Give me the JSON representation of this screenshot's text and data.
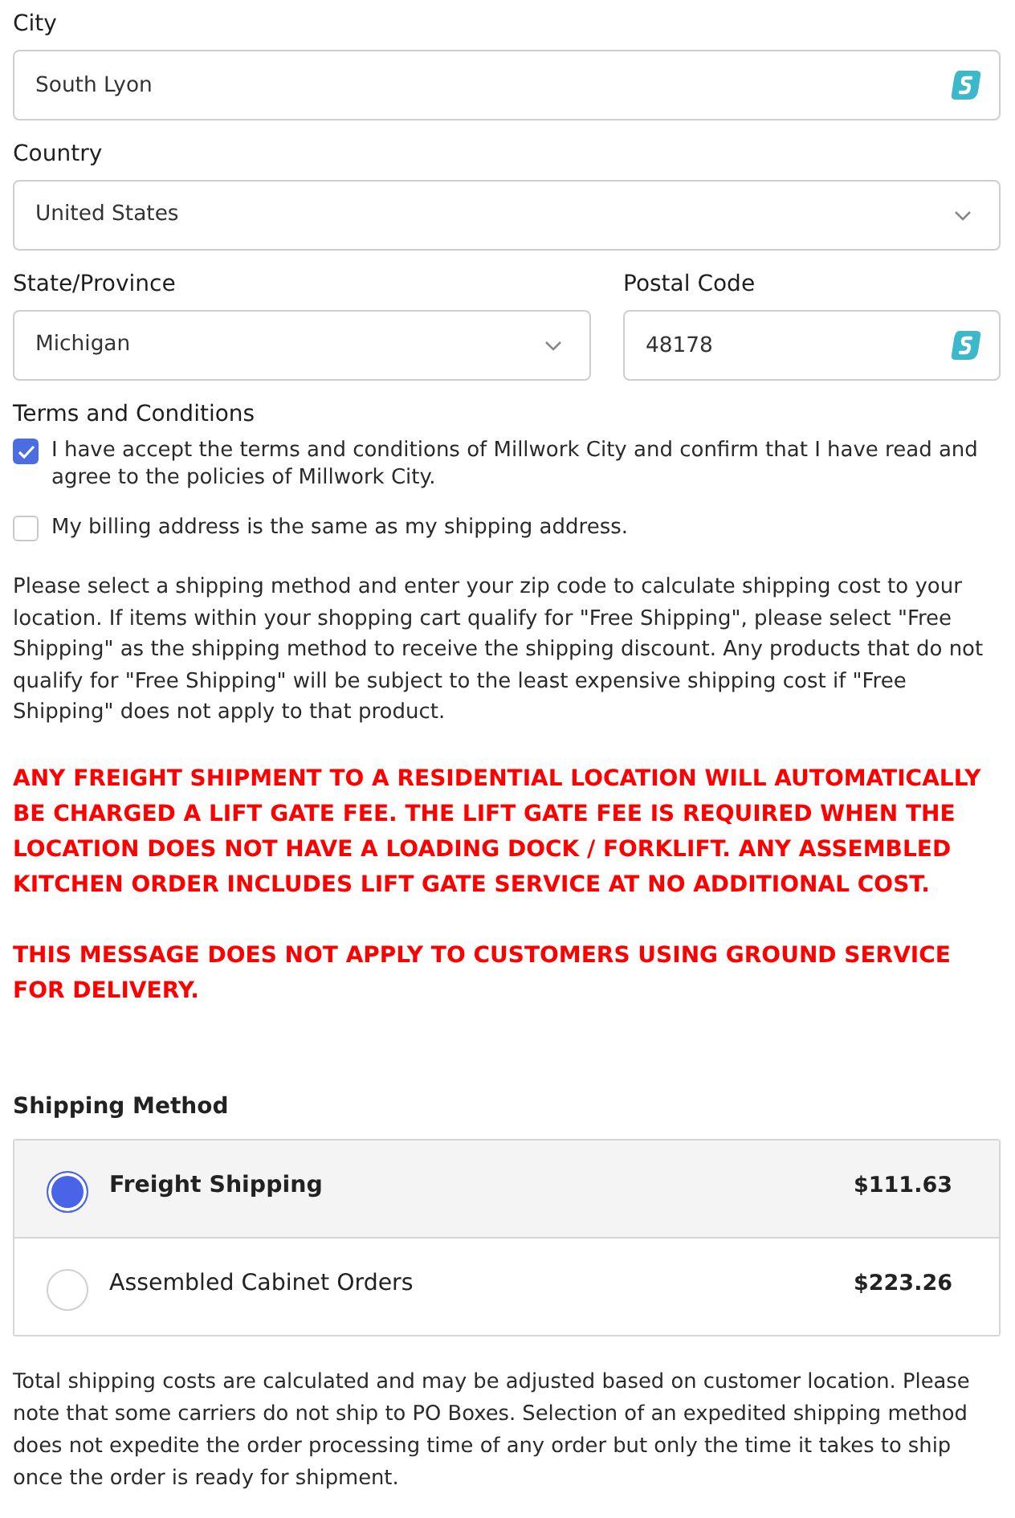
{
  "address_rows": [
    {
      "fields": [
        {
          "kind": "text",
          "label": "City",
          "value": "South Lyon"
        }
      ]
    },
    {
      "fields": [
        {
          "kind": "select",
          "label": "Country",
          "value": "United States"
        }
      ]
    },
    {
      "fields": [
        {
          "kind": "select",
          "label": "State/Province",
          "value": "Michigan"
        },
        {
          "kind": "text",
          "label": "Postal Code",
          "value": "48178"
        }
      ]
    }
  ],
  "terms": {
    "heading": "Terms and Conditions",
    "checkboxes": [
      {
        "label": "I have accept the terms and conditions of Millwork City and confirm that I have read and agree to the policies of Millwork City.",
        "checked": true
      },
      {
        "label": "My billing address is the same as my shipping address.",
        "checked": false
      }
    ]
  },
  "shipping_note": "Please select a shipping method and enter your zip code to calculate shipping cost to your location. If items within your shopping cart qualify for \"Free Shipping\", please select \"Free Shipping\" as the shipping method to receive the shipping discount. Any products that do not qualify for \"Free Shipping\" will be subject to the least expensive shipping cost if \"Free Shipping\" does not apply to that product.",
  "warnings": [
    "ANY FREIGHT SHIPMENT TO A RESIDENTIAL LOCATION WILL AUTOMATICALLY BE CHARGED A LIFT GATE FEE. THE LIFT GATE FEE IS REQUIRED WHEN THE LOCATION DOES NOT HAVE A LOADING DOCK / FORKLIFT. ANY ASSEMBLED KITCHEN ORDER INCLUDES LIFT GATE SERVICE AT NO ADDITIONAL COST.",
    "THIS MESSAGE DOES NOT APPLY TO CUSTOMERS USING GROUND SERVICE FOR DELIVERY."
  ],
  "shipping_method": {
    "heading": "Shipping Method",
    "options": [
      {
        "name": "Freight Shipping",
        "price": "$111.63",
        "selected": true
      },
      {
        "name": "Assembled Cabinet Orders",
        "price": "$223.26",
        "selected": false
      }
    ]
  },
  "footer_note": "Total shipping costs are calculated and may be adjusted based on customer location. Please note that some carriers do not ship to PO Boxes. Selection of an expedited shipping method does not expedite the order processing time of any order but only the time it takes to ship once the order is ready for shipment."
}
